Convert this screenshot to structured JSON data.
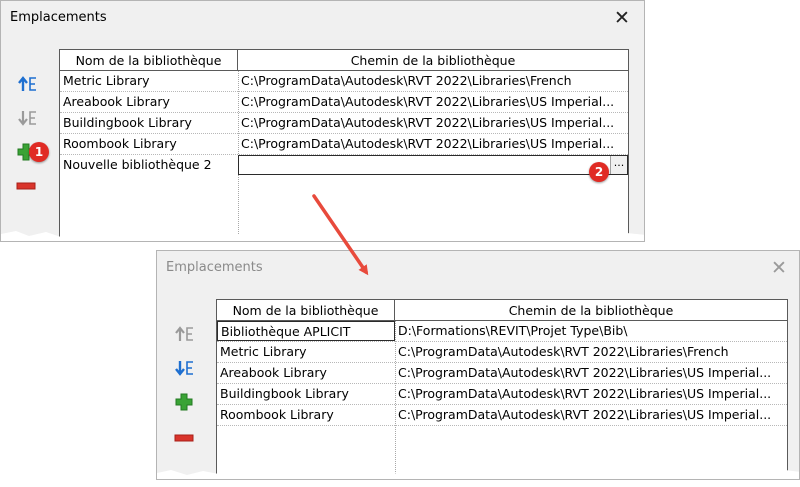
{
  "dialog_top": {
    "title": "Emplacements",
    "table": {
      "col_name": "Nom de la bibliothèque",
      "col_path": "Chemin de la bibliothèque",
      "rows": [
        {
          "name": "Metric Library",
          "path": "C:\\ProgramData\\Autodesk\\RVT 2022\\Libraries\\French"
        },
        {
          "name": "Areabook Library",
          "path": "C:\\ProgramData\\Autodesk\\RVT 2022\\Libraries\\US Imperial..."
        },
        {
          "name": "Buildingbook Library",
          "path": "C:\\ProgramData\\Autodesk\\RVT 2022\\Libraries\\US Imperial..."
        },
        {
          "name": "Roombook Library",
          "path": "C:\\ProgramData\\Autodesk\\RVT 2022\\Libraries\\US Imperial..."
        },
        {
          "name": "Nouvelle bibliothèque 2",
          "path": ""
        }
      ]
    },
    "browse_label": "...",
    "callouts": [
      "1",
      "2"
    ]
  },
  "dialog_bottom": {
    "title": "Emplacements",
    "table": {
      "col_name": "Nom de la bibliothèque",
      "col_path": "Chemin de la bibliothèque",
      "rows": [
        {
          "name": "Bibliothèque APLICIT",
          "path": "D:\\Formations\\REVIT\\Projet Type\\Bib\\"
        },
        {
          "name": "Metric Library",
          "path": "C:\\ProgramData\\Autodesk\\RVT 2022\\Libraries\\French"
        },
        {
          "name": "Areabook Library",
          "path": "C:\\ProgramData\\Autodesk\\RVT 2022\\Libraries\\US Imperial..."
        },
        {
          "name": "Buildingbook Library",
          "path": "C:\\ProgramData\\Autodesk\\RVT 2022\\Libraries\\US Imperial..."
        },
        {
          "name": "Roombook Library",
          "path": "C:\\ProgramData\\Autodesk\\RVT 2022\\Libraries\\US Imperial..."
        }
      ]
    }
  },
  "icons": {
    "move_up": "move-up-icon",
    "move_down": "move-down-icon",
    "add": "add-icon",
    "remove": "remove-icon",
    "close": "close-icon"
  },
  "colors": {
    "accent_blue": "#1e6fd0",
    "add_green": "#3aa335",
    "remove_red": "#d9342b",
    "callout_red": "#e02b24",
    "dialog_bg": "#f0f0f0"
  }
}
